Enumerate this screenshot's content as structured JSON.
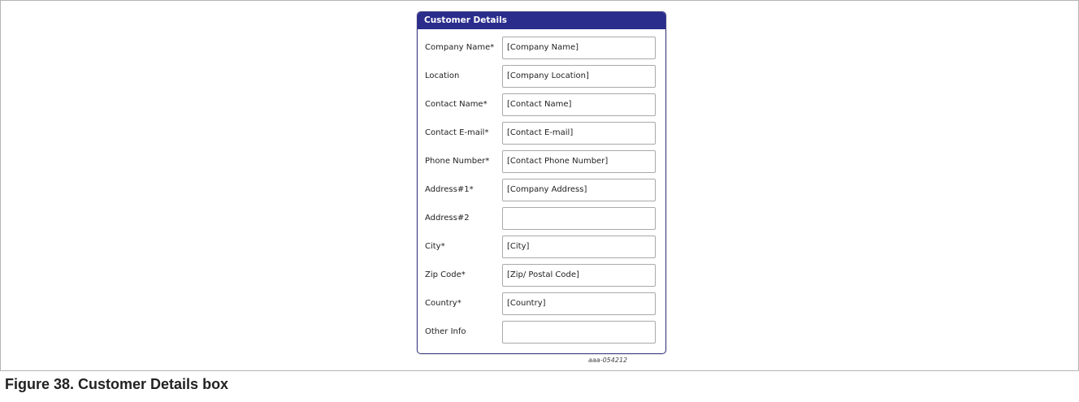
{
  "panel": {
    "title": "Customer Details",
    "header_color": "#2a2d8c",
    "fields": [
      {
        "label": "Company Name*",
        "value": "[Company Name]"
      },
      {
        "label": "Location",
        "value": "[Company Location]"
      },
      {
        "label": "Contact Name*",
        "value": "[Contact Name]"
      },
      {
        "label": "Contact E-mail*",
        "value": "[Contact E-mail]"
      },
      {
        "label": "Phone Number*",
        "value": "[Contact Phone Number]"
      },
      {
        "label": "Address#1*",
        "value": "[Company Address]"
      },
      {
        "label": "Address#2",
        "value": ""
      },
      {
        "label": "City*",
        "value": "[City]"
      },
      {
        "label": "Zip Code*",
        "value": "[Zip/ Postal Code]"
      },
      {
        "label": "Country*",
        "value": "[Country]"
      },
      {
        "label": "Other Info",
        "value": ""
      }
    ]
  },
  "figure": {
    "ref_code": "aaa-054212",
    "caption": "Figure 38.  Customer Details box"
  }
}
